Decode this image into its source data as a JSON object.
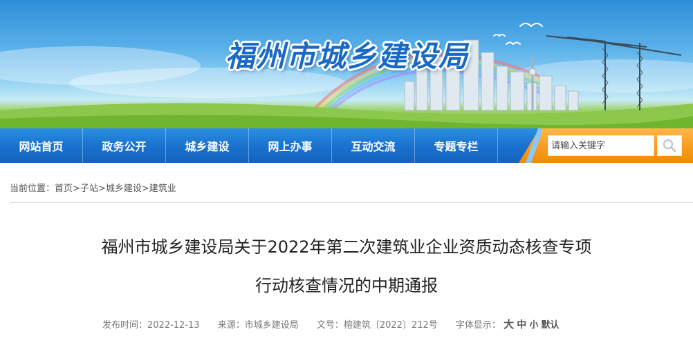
{
  "header": {
    "site_title": "福州市城乡建设局"
  },
  "nav": {
    "items": [
      {
        "label": "网站首页"
      },
      {
        "label": "政务公开"
      },
      {
        "label": "城乡建设"
      },
      {
        "label": "网上办事"
      },
      {
        "label": "互动交流"
      },
      {
        "label": "专题专栏"
      }
    ]
  },
  "search": {
    "placeholder": "请输入关键字",
    "icon": "search-icon"
  },
  "breadcrumb": {
    "prefix": "当前位置：",
    "items": [
      "首页",
      "子站",
      "城乡建设",
      "建筑业"
    ],
    "separator": ">"
  },
  "article": {
    "title_line1": "福州市城乡建设局关于2022年第二次建筑业企业资质动态核查专项",
    "title_line2": "行动核查情况的中期通报",
    "meta": {
      "date": "发布时间：2022-12-13",
      "source": "来源：市城乡建设局",
      "doc_no": "文号：榕建筑〔2022〕212号",
      "font_label": "字体显示：",
      "font_large": "大",
      "font_medium": "中",
      "font_small": "小",
      "font_default": "默认"
    }
  },
  "colors": {
    "nav_blue": "#1a72cf",
    "nav_orange": "#f79a1a",
    "title_blue": "#1a69c4"
  }
}
